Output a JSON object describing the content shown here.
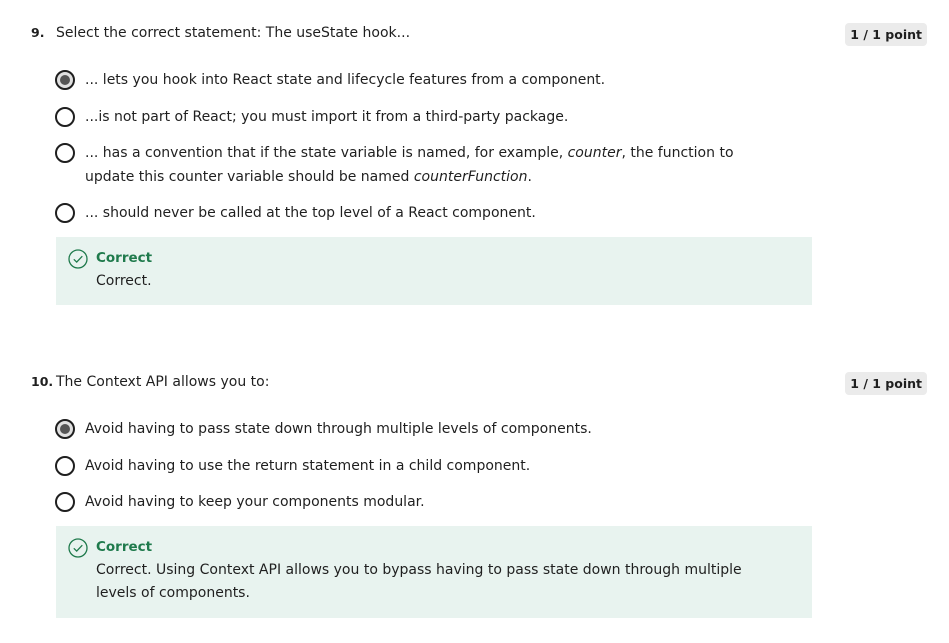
{
  "q9": {
    "number": "9.",
    "text": "Select the correct statement: The useState hook...",
    "points": "1 / 1 point",
    "options": [
      {
        "text": "... lets you hook into React state and lifecycle features from a component.",
        "selected": true
      },
      {
        "text": "...is not  part of React; you must import it from a third-party package.",
        "selected": false
      },
      {
        "pre": "... has a convention that if the state variable is named, for example, ",
        "em1": "counter",
        "mid": ", the function to update this counter variable should be named ",
        "em2": "counterFunction",
        "post": ".",
        "selected": false
      },
      {
        "text": "... should never be called at the top level of a React component.",
        "selected": false
      }
    ],
    "feedback": {
      "title": "Correct",
      "text": "Correct."
    }
  },
  "q10": {
    "number": "10.",
    "text": "The Context API allows you to:",
    "points": "1 / 1 point",
    "options": [
      {
        "text": "Avoid having to pass state down through multiple levels of components.",
        "selected": true
      },
      {
        "text": "Avoid having to use the return statement in a child component.",
        "selected": false
      },
      {
        "text": "Avoid having to keep your components modular.",
        "selected": false
      }
    ],
    "feedback": {
      "title": "Correct",
      "text": "Correct. Using Context API allows you to bypass having to pass state down through multiple levels of components."
    }
  },
  "colors": {
    "correct_green": "#1f7a4c",
    "feedback_bg": "#e8f3ef",
    "badge_bg": "#ebebeb"
  },
  "icons": {
    "feedback_icon": "check-circle-icon",
    "radio": "radio-button-icon"
  }
}
